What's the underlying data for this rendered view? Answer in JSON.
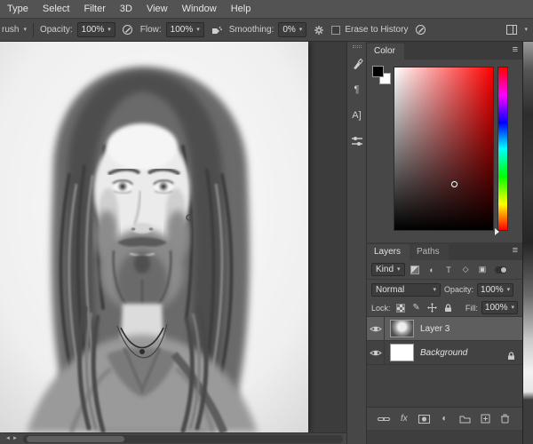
{
  "menu": {
    "items": [
      "Type",
      "Select",
      "Filter",
      "3D",
      "View",
      "Window",
      "Help"
    ]
  },
  "options": {
    "tool_label": "rush",
    "opacity_label": "Opacity:",
    "opacity_value": "100%",
    "flow_label": "Flow:",
    "flow_value": "100%",
    "smoothing_label": "Smoothing:",
    "smoothing_value": "0%",
    "erase_label": "Erase to History"
  },
  "color_panel": {
    "title": "Color",
    "foreground_color": "#000000",
    "background_color": "#ffffff",
    "hue": "#ff0000"
  },
  "layers_panel": {
    "tabs": [
      "Layers",
      "Paths"
    ],
    "kind_label": "Kind",
    "blend_mode": "Normal",
    "opacity_label": "Opacity:",
    "opacity_value": "100%",
    "lock_label": "Lock:",
    "fill_label": "Fill:",
    "fill_value": "100%",
    "layers": [
      {
        "name": "Layer 3",
        "selected": true,
        "visible": true
      },
      {
        "name": "Background",
        "selected": false,
        "visible": true,
        "locked": true
      }
    ]
  },
  "icons": {
    "dropdown_arrow": "▾",
    "panel_menu": "≡",
    "paragraph": "¶",
    "character_styles": "A]",
    "type_filter": "T",
    "shape_filter": "◇",
    "smart_object_filter": "▣",
    "adjustment": "◐",
    "fx": "fx",
    "brush_lock": "✎",
    "scroll_left": "◄",
    "scroll_right": "►"
  },
  "colors": {
    "menu_bg": "#535353",
    "panel_bg": "#474747",
    "selected_layer_bg": "#5e5e5e",
    "canvas_pasteboard": "#3c3c3c"
  }
}
